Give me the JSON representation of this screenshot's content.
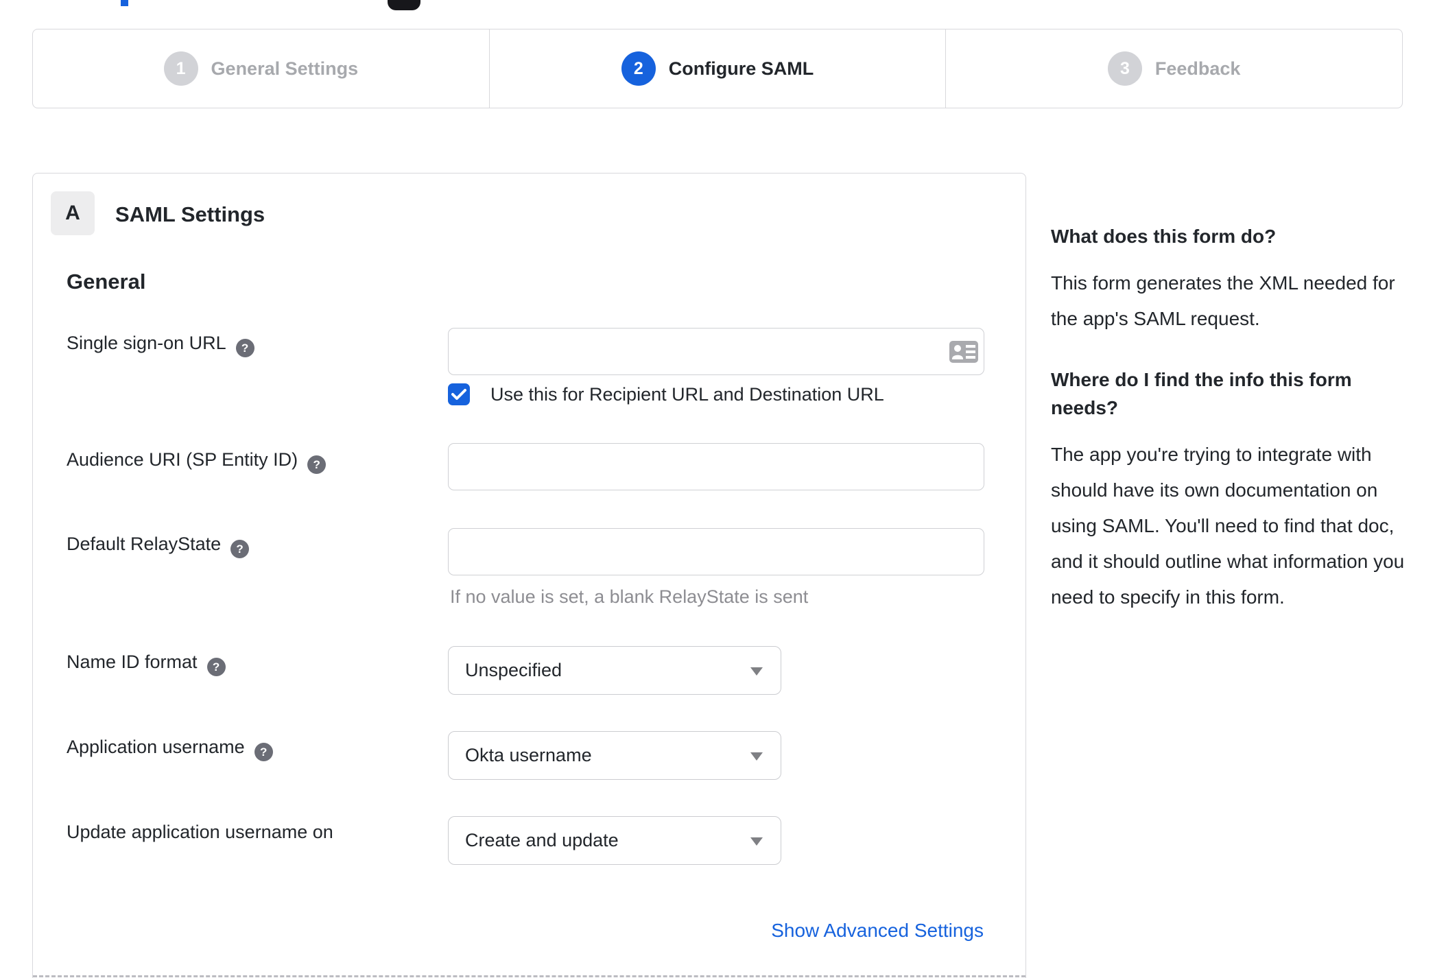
{
  "colors": {
    "accent_blue": "#1662dd",
    "inactive_gray": "#d2d3d7",
    "border_gray": "#d8d8dc",
    "hint_gray": "#8d8d92",
    "text_dark": "#22262b"
  },
  "icons": {
    "help_glyph": "?"
  },
  "stepper": {
    "steps": [
      {
        "number": "1",
        "label": "General Settings",
        "state": "inactive"
      },
      {
        "number": "2",
        "label": "Configure SAML",
        "state": "active"
      },
      {
        "number": "3",
        "label": "Feedback",
        "state": "inactive"
      }
    ]
  },
  "panel": {
    "badge": "A",
    "title": "SAML Settings",
    "group_heading": "General"
  },
  "form": {
    "sso": {
      "label": "Single sign-on URL",
      "value": "",
      "checkbox_label": "Use this for Recipient URL and Destination URL",
      "checkbox_checked": true
    },
    "audience": {
      "label": "Audience URI (SP Entity ID)",
      "value": ""
    },
    "relay": {
      "label": "Default RelayState",
      "value": "",
      "hint": "If no value is set, a blank RelayState is sent"
    },
    "name_id": {
      "label": "Name ID format",
      "value": "Unspecified"
    },
    "app_username": {
      "label": "Application username",
      "value": "Okta username"
    },
    "update_username": {
      "label": "Update application username on",
      "value": "Create and update"
    },
    "advanced_link": "Show Advanced Settings"
  },
  "help": {
    "sections": [
      {
        "heading": "What does this form do?",
        "body": "This form generates the XML needed for the app's SAML request."
      },
      {
        "heading": "Where do I find the info this form needs?",
        "body": "The app you're trying to integrate with should have its own documentation on using SAML. You'll need to find that doc, and it should outline what information you need to specify in this form."
      }
    ]
  }
}
